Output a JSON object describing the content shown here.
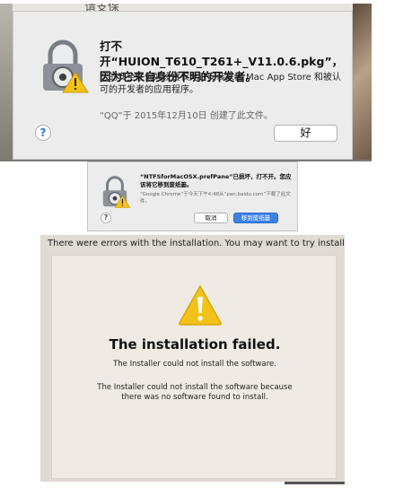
{
  "background_fragment": "请支保",
  "dialog1": {
    "title": "打不开“HUION_T610_T261+_V11.0.6.pkg”，因为它来自身份不明的开发者。",
    "body": "您的安全性偏好设置仅允许安装来自 Mac App Store 和被认可的开发者的应用程序。",
    "note": "“QQ”于 2015年12月10日 创建了此文件。",
    "help_label": "?",
    "ok_label": "好",
    "icon": "gatekeeper-warning-icon"
  },
  "dialog2": {
    "title": "“NTFSforMacOSX.prefPane”已损坏，打不开。您应该将它移到废纸篓。",
    "body": "“Google Chrome”于今天下午4:48从“pan.baidu.com”下载了此文件。",
    "help_label": "?",
    "cancel_label": "取消",
    "trash_label": "移到废纸篓",
    "icon": "gatekeeper-warning-icon"
  },
  "installer": {
    "header": "There were errors with the installation. You may want to try installing",
    "failed_title": "The installation failed.",
    "message1": "The Installer could not install the software.",
    "message2": "The Installer could not install the software because there was no software found to install.",
    "icon": "warning-triangle-icon"
  },
  "colors": {
    "accent_blue": "#3d82e6",
    "warning_yellow": "#f2c21a",
    "dialog_bg": "#ececec"
  }
}
